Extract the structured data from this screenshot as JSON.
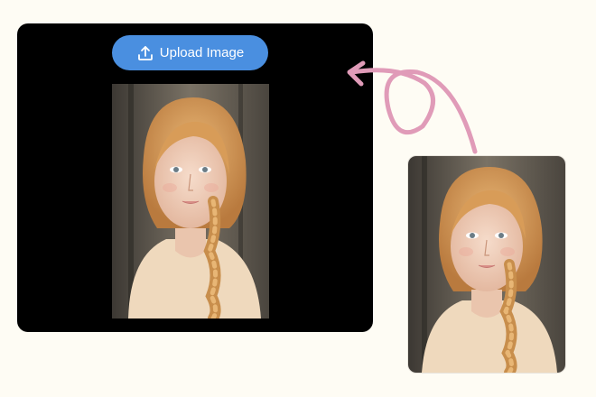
{
  "upload": {
    "label": "Upload Image",
    "icon": "upload-icon"
  },
  "colors": {
    "background": "#fefcf4",
    "panel": "#000000",
    "button": "#4a8fe0",
    "arrow": "#e09bb8"
  },
  "main_image": {
    "subject": "portrait-photo"
  },
  "thumbnail": {
    "subject": "portrait-photo"
  }
}
